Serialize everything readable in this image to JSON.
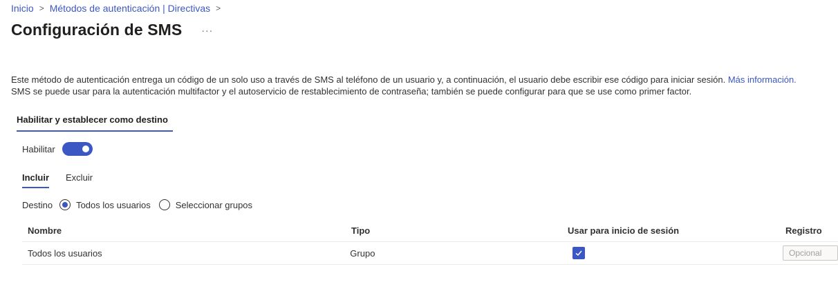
{
  "breadcrumb": {
    "items": [
      "Inicio",
      "Métodos de autenticación | Directivas"
    ],
    "separator": ">"
  },
  "page": {
    "title": "Configuración de SMS",
    "more": "···"
  },
  "description": {
    "line1": "Este método de autenticación entrega un código de un solo uso a través de SMS al teléfono de un usuario y, a continuación, el usuario debe escribir ese código para iniciar sesión.",
    "link": "Más información.",
    "line2": "SMS se puede usar para la autenticación multifactor y el autoservicio de restablecimiento de contraseña; también se puede configurar para que se use como primer factor."
  },
  "section_tab": "Habilitar y establecer como destino",
  "enable": {
    "label": "Habilitar",
    "on": true
  },
  "tabs": [
    {
      "label": "Incluir",
      "active": true
    },
    {
      "label": "Excluir",
      "active": false
    }
  ],
  "destination": {
    "label": "Destino",
    "options": [
      {
        "label": "Todos los usuarios",
        "checked": true
      },
      {
        "label": "Seleccionar grupos",
        "checked": false
      }
    ]
  },
  "table": {
    "headers": [
      "Nombre",
      "Tipo",
      "Usar para inicio de sesión",
      "Registro"
    ],
    "rows": [
      {
        "name": "Todos los usuarios",
        "type": "Grupo",
        "signin": true,
        "registration": "Opcional"
      }
    ]
  },
  "colors": {
    "accent": "#3b57c4",
    "text": "#323130",
    "border": "#edebe9"
  }
}
